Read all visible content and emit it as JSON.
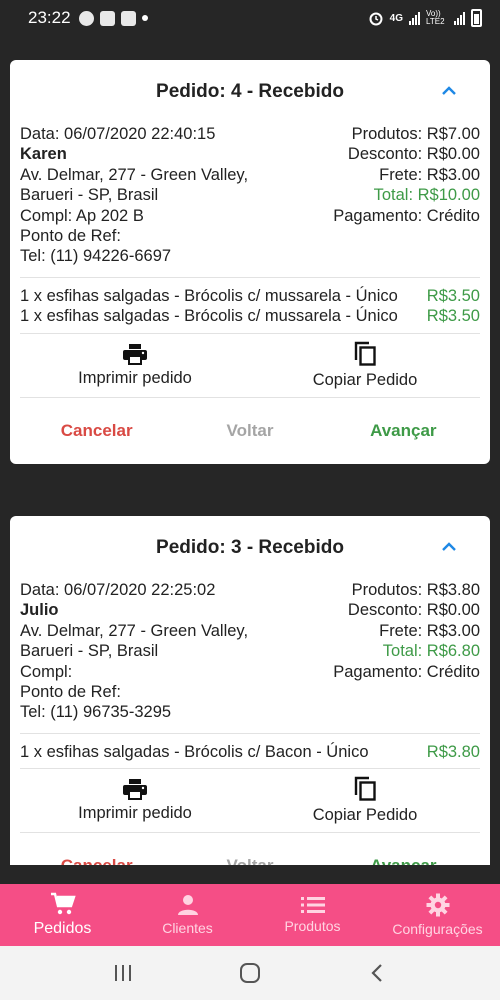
{
  "status_bar": {
    "time": "23:22",
    "network_label": "4G",
    "lte_label": "Vo)) LTE2"
  },
  "orders": [
    {
      "title": "Pedido: 4 - Recebido",
      "date": "Data: 06/07/2020 22:40:15",
      "customer": "Karen",
      "address_line1": "Av. Delmar, 277 - Green Valley,",
      "address_line2": "Barueri - SP, Brasil",
      "complement": "Compl: Ap 202 B",
      "reference": "Ponto de Ref:",
      "phone": "Tel: (11) 94226-6697",
      "products": "Produtos: R$7.00",
      "discount": "Desconto: R$0.00",
      "shipping": "Frete: R$3.00",
      "total": "Total: R$10.00",
      "payment": "Pagamento: Crédito",
      "items": [
        {
          "name": "1 x esfihas salgadas - Brócolis c/ mussarela - Único",
          "price": "R$3.50"
        },
        {
          "name": "1 x esfihas salgadas - Brócolis c/ mussarela - Único",
          "price": "R$3.50"
        }
      ],
      "print_label": "Imprimir pedido",
      "copy_label": "Copiar Pedido",
      "cancel_label": "Cancelar",
      "back_label": "Voltar",
      "advance_label": "Avançar"
    },
    {
      "title": "Pedido: 3 - Recebido",
      "date": "Data: 06/07/2020 22:25:02",
      "customer": "Julio",
      "address_line1": "Av. Delmar, 277 - Green Valley,",
      "address_line2": "Barueri - SP, Brasil",
      "complement": "Compl:",
      "reference": "Ponto de Ref:",
      "phone": "Tel: (11) 96735-3295",
      "products": "Produtos: R$3.80",
      "discount": "Desconto: R$0.00",
      "shipping": "Frete: R$3.00",
      "total": "Total: R$6.80",
      "payment": "Pagamento: Crédito",
      "items": [
        {
          "name": "1 x esfihas salgadas - Brócolis c/ Bacon - Único",
          "price": "R$3.80"
        }
      ],
      "print_label": "Imprimir pedido",
      "copy_label": "Copiar Pedido",
      "cancel_label": "Cancelar",
      "back_label": "Voltar",
      "advance_label": "Avançar"
    }
  ],
  "bottom_nav": [
    {
      "label": "Pedidos",
      "icon": "cart-icon",
      "active": true
    },
    {
      "label": "Clientes",
      "icon": "person-icon",
      "active": false
    },
    {
      "label": "Produtos",
      "icon": "list-icon",
      "active": false
    },
    {
      "label": "Configurações",
      "icon": "gear-icon",
      "active": false
    }
  ],
  "colors": {
    "accent_pink": "#f54e86",
    "green": "#3e9a47",
    "red": "#d94a44",
    "collapse_blue": "#1e88e5"
  }
}
